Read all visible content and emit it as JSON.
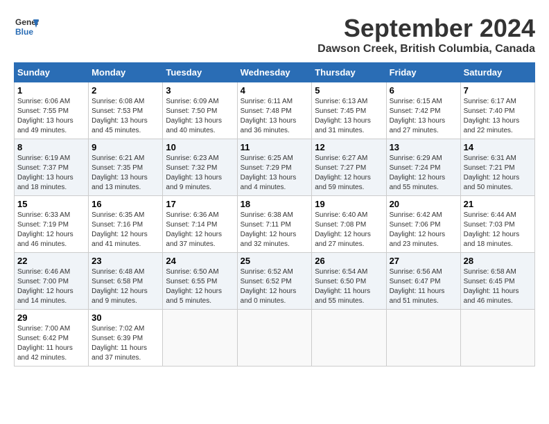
{
  "header": {
    "logo_line1": "General",
    "logo_line2": "Blue",
    "month_title": "September 2024",
    "location": "Dawson Creek, British Columbia, Canada"
  },
  "days_of_week": [
    "Sunday",
    "Monday",
    "Tuesday",
    "Wednesday",
    "Thursday",
    "Friday",
    "Saturday"
  ],
  "weeks": [
    [
      {
        "day": "1",
        "sunrise": "Sunrise: 6:06 AM",
        "sunset": "Sunset: 7:55 PM",
        "daylight": "Daylight: 13 hours and 49 minutes."
      },
      {
        "day": "2",
        "sunrise": "Sunrise: 6:08 AM",
        "sunset": "Sunset: 7:53 PM",
        "daylight": "Daylight: 13 hours and 45 minutes."
      },
      {
        "day": "3",
        "sunrise": "Sunrise: 6:09 AM",
        "sunset": "Sunset: 7:50 PM",
        "daylight": "Daylight: 13 hours and 40 minutes."
      },
      {
        "day": "4",
        "sunrise": "Sunrise: 6:11 AM",
        "sunset": "Sunset: 7:48 PM",
        "daylight": "Daylight: 13 hours and 36 minutes."
      },
      {
        "day": "5",
        "sunrise": "Sunrise: 6:13 AM",
        "sunset": "Sunset: 7:45 PM",
        "daylight": "Daylight: 13 hours and 31 minutes."
      },
      {
        "day": "6",
        "sunrise": "Sunrise: 6:15 AM",
        "sunset": "Sunset: 7:42 PM",
        "daylight": "Daylight: 13 hours and 27 minutes."
      },
      {
        "day": "7",
        "sunrise": "Sunrise: 6:17 AM",
        "sunset": "Sunset: 7:40 PM",
        "daylight": "Daylight: 13 hours and 22 minutes."
      }
    ],
    [
      {
        "day": "8",
        "sunrise": "Sunrise: 6:19 AM",
        "sunset": "Sunset: 7:37 PM",
        "daylight": "Daylight: 13 hours and 18 minutes."
      },
      {
        "day": "9",
        "sunrise": "Sunrise: 6:21 AM",
        "sunset": "Sunset: 7:35 PM",
        "daylight": "Daylight: 13 hours and 13 minutes."
      },
      {
        "day": "10",
        "sunrise": "Sunrise: 6:23 AM",
        "sunset": "Sunset: 7:32 PM",
        "daylight": "Daylight: 13 hours and 9 minutes."
      },
      {
        "day": "11",
        "sunrise": "Sunrise: 6:25 AM",
        "sunset": "Sunset: 7:29 PM",
        "daylight": "Daylight: 13 hours and 4 minutes."
      },
      {
        "day": "12",
        "sunrise": "Sunrise: 6:27 AM",
        "sunset": "Sunset: 7:27 PM",
        "daylight": "Daylight: 12 hours and 59 minutes."
      },
      {
        "day": "13",
        "sunrise": "Sunrise: 6:29 AM",
        "sunset": "Sunset: 7:24 PM",
        "daylight": "Daylight: 12 hours and 55 minutes."
      },
      {
        "day": "14",
        "sunrise": "Sunrise: 6:31 AM",
        "sunset": "Sunset: 7:21 PM",
        "daylight": "Daylight: 12 hours and 50 minutes."
      }
    ],
    [
      {
        "day": "15",
        "sunrise": "Sunrise: 6:33 AM",
        "sunset": "Sunset: 7:19 PM",
        "daylight": "Daylight: 12 hours and 46 minutes."
      },
      {
        "day": "16",
        "sunrise": "Sunrise: 6:35 AM",
        "sunset": "Sunset: 7:16 PM",
        "daylight": "Daylight: 12 hours and 41 minutes."
      },
      {
        "day": "17",
        "sunrise": "Sunrise: 6:36 AM",
        "sunset": "Sunset: 7:14 PM",
        "daylight": "Daylight: 12 hours and 37 minutes."
      },
      {
        "day": "18",
        "sunrise": "Sunrise: 6:38 AM",
        "sunset": "Sunset: 7:11 PM",
        "daylight": "Daylight: 12 hours and 32 minutes."
      },
      {
        "day": "19",
        "sunrise": "Sunrise: 6:40 AM",
        "sunset": "Sunset: 7:08 PM",
        "daylight": "Daylight: 12 hours and 27 minutes."
      },
      {
        "day": "20",
        "sunrise": "Sunrise: 6:42 AM",
        "sunset": "Sunset: 7:06 PM",
        "daylight": "Daylight: 12 hours and 23 minutes."
      },
      {
        "day": "21",
        "sunrise": "Sunrise: 6:44 AM",
        "sunset": "Sunset: 7:03 PM",
        "daylight": "Daylight: 12 hours and 18 minutes."
      }
    ],
    [
      {
        "day": "22",
        "sunrise": "Sunrise: 6:46 AM",
        "sunset": "Sunset: 7:00 PM",
        "daylight": "Daylight: 12 hours and 14 minutes."
      },
      {
        "day": "23",
        "sunrise": "Sunrise: 6:48 AM",
        "sunset": "Sunset: 6:58 PM",
        "daylight": "Daylight: 12 hours and 9 minutes."
      },
      {
        "day": "24",
        "sunrise": "Sunrise: 6:50 AM",
        "sunset": "Sunset: 6:55 PM",
        "daylight": "Daylight: 12 hours and 5 minutes."
      },
      {
        "day": "25",
        "sunrise": "Sunrise: 6:52 AM",
        "sunset": "Sunset: 6:52 PM",
        "daylight": "Daylight: 12 hours and 0 minutes."
      },
      {
        "day": "26",
        "sunrise": "Sunrise: 6:54 AM",
        "sunset": "Sunset: 6:50 PM",
        "daylight": "Daylight: 11 hours and 55 minutes."
      },
      {
        "day": "27",
        "sunrise": "Sunrise: 6:56 AM",
        "sunset": "Sunset: 6:47 PM",
        "daylight": "Daylight: 11 hours and 51 minutes."
      },
      {
        "day": "28",
        "sunrise": "Sunrise: 6:58 AM",
        "sunset": "Sunset: 6:45 PM",
        "daylight": "Daylight: 11 hours and 46 minutes."
      }
    ],
    [
      {
        "day": "29",
        "sunrise": "Sunrise: 7:00 AM",
        "sunset": "Sunset: 6:42 PM",
        "daylight": "Daylight: 11 hours and 42 minutes."
      },
      {
        "day": "30",
        "sunrise": "Sunrise: 7:02 AM",
        "sunset": "Sunset: 6:39 PM",
        "daylight": "Daylight: 11 hours and 37 minutes."
      },
      null,
      null,
      null,
      null,
      null
    ]
  ]
}
